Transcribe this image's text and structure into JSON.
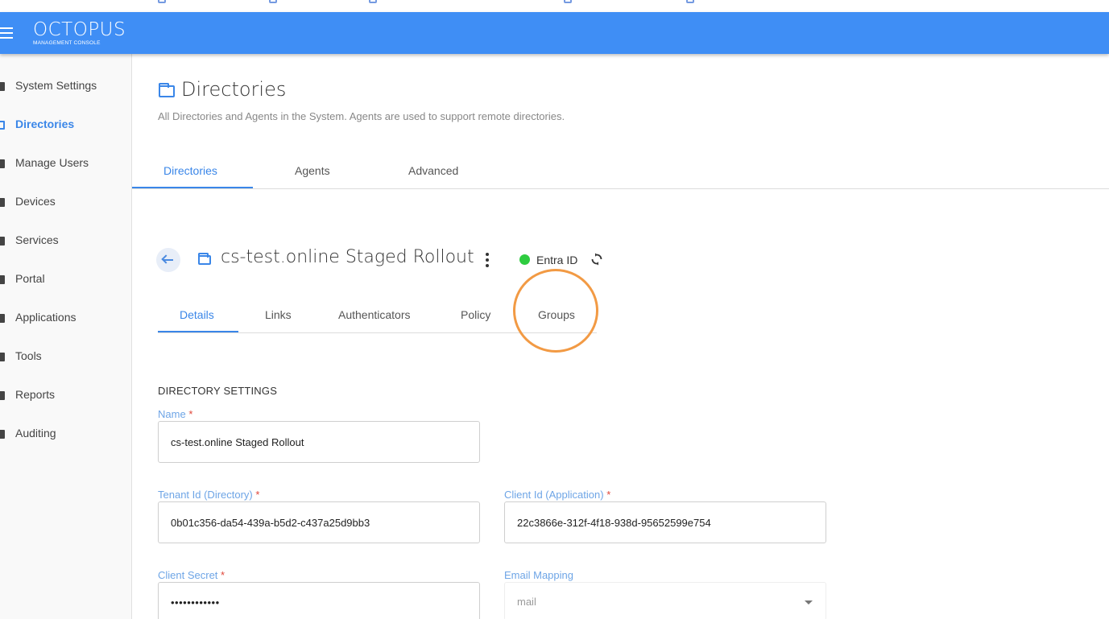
{
  "app": {
    "brand": "OCTOPUS",
    "brand_sub": "MANAGEMENT CONSOLE",
    "accent_color": "#3f8ef5"
  },
  "sidebar": {
    "items": [
      {
        "label": "System Settings",
        "icon": "settings-icon"
      },
      {
        "label": "Directories",
        "icon": "folder-icon",
        "active": true
      },
      {
        "label": "Manage Users",
        "icon": "users-icon"
      },
      {
        "label": "Devices",
        "icon": "device-icon"
      },
      {
        "label": "Services",
        "icon": "services-icon"
      },
      {
        "label": "Portal",
        "icon": "portal-icon"
      },
      {
        "label": "Applications",
        "icon": "applications-icon"
      },
      {
        "label": "Tools",
        "icon": "tools-icon"
      },
      {
        "label": "Reports",
        "icon": "reports-icon"
      },
      {
        "label": "Auditing",
        "icon": "auditing-icon"
      }
    ]
  },
  "page": {
    "title": "Directories",
    "description": "All Directories and Agents in the System. Agents are used to support remote directories.",
    "tabs": [
      {
        "label": "Directories",
        "active": true
      },
      {
        "label": "Agents"
      },
      {
        "label": "Advanced"
      }
    ]
  },
  "directory": {
    "title": "cs-test.online Staged Rollout",
    "status_label": "Entra ID",
    "status_color": "#2ecc40",
    "tabs": [
      {
        "label": "Details",
        "active": true
      },
      {
        "label": "Links"
      },
      {
        "label": "Authenticators"
      },
      {
        "label": "Policy"
      },
      {
        "label": "Groups",
        "highlighted": true
      }
    ],
    "highlight_color": "#f29a44"
  },
  "form": {
    "section_title": "DIRECTORY SETTINGS",
    "required_mark": "*",
    "name": {
      "label": "Name",
      "value": "cs-test.online Staged Rollout"
    },
    "tenant_id": {
      "label": "Tenant Id (Directory)",
      "value": "0b01c356-da54-439a-b5d2-c437a25d9bb3"
    },
    "client_id": {
      "label": "Client Id (Application)",
      "value": "22c3866e-312f-4f18-938d-95652599e754"
    },
    "client_secret": {
      "label": "Client Secret",
      "value": "••••••••••••"
    },
    "email_mapping": {
      "label": "Email Mapping",
      "value": "mail"
    }
  }
}
